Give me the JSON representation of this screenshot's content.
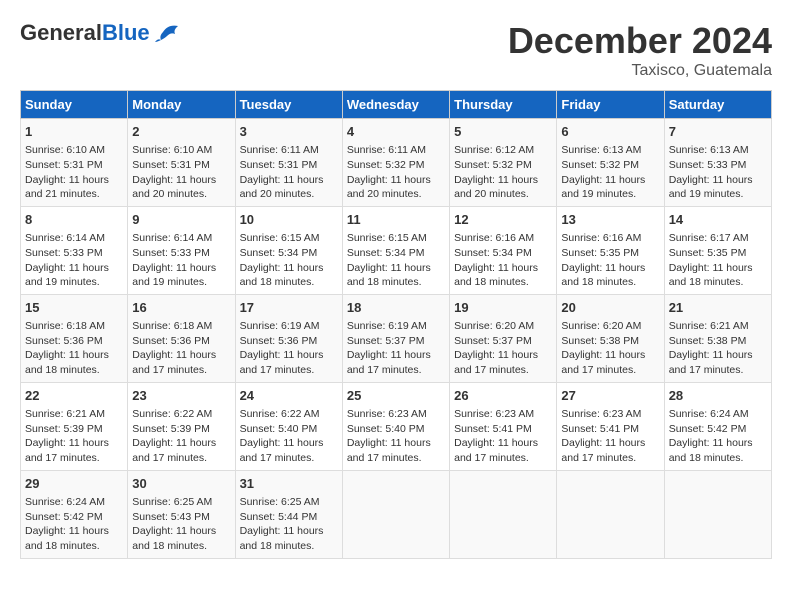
{
  "logo": {
    "general": "General",
    "blue": "Blue"
  },
  "header": {
    "month": "December 2024",
    "location": "Taxisco, Guatemala"
  },
  "weekdays": [
    "Sunday",
    "Monday",
    "Tuesday",
    "Wednesday",
    "Thursday",
    "Friday",
    "Saturday"
  ],
  "weeks": [
    [
      {
        "day": "1",
        "lines": [
          "Sunrise: 6:10 AM",
          "Sunset: 5:31 PM",
          "Daylight: 11 hours",
          "and 21 minutes."
        ]
      },
      {
        "day": "2",
        "lines": [
          "Sunrise: 6:10 AM",
          "Sunset: 5:31 PM",
          "Daylight: 11 hours",
          "and 20 minutes."
        ]
      },
      {
        "day": "3",
        "lines": [
          "Sunrise: 6:11 AM",
          "Sunset: 5:31 PM",
          "Daylight: 11 hours",
          "and 20 minutes."
        ]
      },
      {
        "day": "4",
        "lines": [
          "Sunrise: 6:11 AM",
          "Sunset: 5:32 PM",
          "Daylight: 11 hours",
          "and 20 minutes."
        ]
      },
      {
        "day": "5",
        "lines": [
          "Sunrise: 6:12 AM",
          "Sunset: 5:32 PM",
          "Daylight: 11 hours",
          "and 20 minutes."
        ]
      },
      {
        "day": "6",
        "lines": [
          "Sunrise: 6:13 AM",
          "Sunset: 5:32 PM",
          "Daylight: 11 hours",
          "and 19 minutes."
        ]
      },
      {
        "day": "7",
        "lines": [
          "Sunrise: 6:13 AM",
          "Sunset: 5:33 PM",
          "Daylight: 11 hours",
          "and 19 minutes."
        ]
      }
    ],
    [
      {
        "day": "8",
        "lines": [
          "Sunrise: 6:14 AM",
          "Sunset: 5:33 PM",
          "Daylight: 11 hours",
          "and 19 minutes."
        ]
      },
      {
        "day": "9",
        "lines": [
          "Sunrise: 6:14 AM",
          "Sunset: 5:33 PM",
          "Daylight: 11 hours",
          "and 19 minutes."
        ]
      },
      {
        "day": "10",
        "lines": [
          "Sunrise: 6:15 AM",
          "Sunset: 5:34 PM",
          "Daylight: 11 hours",
          "and 18 minutes."
        ]
      },
      {
        "day": "11",
        "lines": [
          "Sunrise: 6:15 AM",
          "Sunset: 5:34 PM",
          "Daylight: 11 hours",
          "and 18 minutes."
        ]
      },
      {
        "day": "12",
        "lines": [
          "Sunrise: 6:16 AM",
          "Sunset: 5:34 PM",
          "Daylight: 11 hours",
          "and 18 minutes."
        ]
      },
      {
        "day": "13",
        "lines": [
          "Sunrise: 6:16 AM",
          "Sunset: 5:35 PM",
          "Daylight: 11 hours",
          "and 18 minutes."
        ]
      },
      {
        "day": "14",
        "lines": [
          "Sunrise: 6:17 AM",
          "Sunset: 5:35 PM",
          "Daylight: 11 hours",
          "and 18 minutes."
        ]
      }
    ],
    [
      {
        "day": "15",
        "lines": [
          "Sunrise: 6:18 AM",
          "Sunset: 5:36 PM",
          "Daylight: 11 hours",
          "and 18 minutes."
        ]
      },
      {
        "day": "16",
        "lines": [
          "Sunrise: 6:18 AM",
          "Sunset: 5:36 PM",
          "Daylight: 11 hours",
          "and 17 minutes."
        ]
      },
      {
        "day": "17",
        "lines": [
          "Sunrise: 6:19 AM",
          "Sunset: 5:36 PM",
          "Daylight: 11 hours",
          "and 17 minutes."
        ]
      },
      {
        "day": "18",
        "lines": [
          "Sunrise: 6:19 AM",
          "Sunset: 5:37 PM",
          "Daylight: 11 hours",
          "and 17 minutes."
        ]
      },
      {
        "day": "19",
        "lines": [
          "Sunrise: 6:20 AM",
          "Sunset: 5:37 PM",
          "Daylight: 11 hours",
          "and 17 minutes."
        ]
      },
      {
        "day": "20",
        "lines": [
          "Sunrise: 6:20 AM",
          "Sunset: 5:38 PM",
          "Daylight: 11 hours",
          "and 17 minutes."
        ]
      },
      {
        "day": "21",
        "lines": [
          "Sunrise: 6:21 AM",
          "Sunset: 5:38 PM",
          "Daylight: 11 hours",
          "and 17 minutes."
        ]
      }
    ],
    [
      {
        "day": "22",
        "lines": [
          "Sunrise: 6:21 AM",
          "Sunset: 5:39 PM",
          "Daylight: 11 hours",
          "and 17 minutes."
        ]
      },
      {
        "day": "23",
        "lines": [
          "Sunrise: 6:22 AM",
          "Sunset: 5:39 PM",
          "Daylight: 11 hours",
          "and 17 minutes."
        ]
      },
      {
        "day": "24",
        "lines": [
          "Sunrise: 6:22 AM",
          "Sunset: 5:40 PM",
          "Daylight: 11 hours",
          "and 17 minutes."
        ]
      },
      {
        "day": "25",
        "lines": [
          "Sunrise: 6:23 AM",
          "Sunset: 5:40 PM",
          "Daylight: 11 hours",
          "and 17 minutes."
        ]
      },
      {
        "day": "26",
        "lines": [
          "Sunrise: 6:23 AM",
          "Sunset: 5:41 PM",
          "Daylight: 11 hours",
          "and 17 minutes."
        ]
      },
      {
        "day": "27",
        "lines": [
          "Sunrise: 6:23 AM",
          "Sunset: 5:41 PM",
          "Daylight: 11 hours",
          "and 17 minutes."
        ]
      },
      {
        "day": "28",
        "lines": [
          "Sunrise: 6:24 AM",
          "Sunset: 5:42 PM",
          "Daylight: 11 hours",
          "and 18 minutes."
        ]
      }
    ],
    [
      {
        "day": "29",
        "lines": [
          "Sunrise: 6:24 AM",
          "Sunset: 5:42 PM",
          "Daylight: 11 hours",
          "and 18 minutes."
        ]
      },
      {
        "day": "30",
        "lines": [
          "Sunrise: 6:25 AM",
          "Sunset: 5:43 PM",
          "Daylight: 11 hours",
          "and 18 minutes."
        ]
      },
      {
        "day": "31",
        "lines": [
          "Sunrise: 6:25 AM",
          "Sunset: 5:44 PM",
          "Daylight: 11 hours",
          "and 18 minutes."
        ]
      },
      null,
      null,
      null,
      null
    ]
  ]
}
